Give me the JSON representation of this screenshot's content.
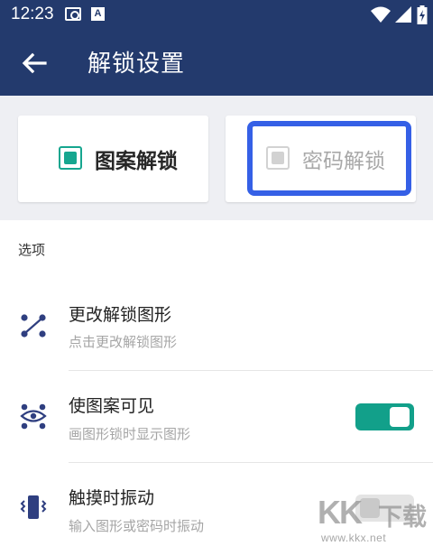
{
  "status_bar": {
    "time": "12:23",
    "notif_icons": [
      "photo-icon",
      "a-icon"
    ],
    "right_icons": [
      "wifi-icon",
      "signal-icon",
      "battery-charging-icon"
    ],
    "a_glyph": "A"
  },
  "app_bar": {
    "title": "解锁设置",
    "back_icon": "back-arrow-icon",
    "color": "#233a6d"
  },
  "unlock_modes": [
    {
      "label": "图案解锁",
      "selected": true,
      "check_color": "#16a68f"
    },
    {
      "label": "密码解锁",
      "selected": false,
      "highlighted": true,
      "highlight_color": "#3560e6"
    }
  ],
  "section": {
    "header": "选项"
  },
  "options": [
    {
      "title": "更改解锁图形",
      "subtitle": "点击更改解锁图形",
      "icon": "pattern-icon",
      "toggle": null
    },
    {
      "title": "使图案可见",
      "subtitle": "画图形锁时显示图形",
      "icon": "eye-pattern-icon",
      "toggle": true
    },
    {
      "title": "触摸时振动",
      "subtitle": "输入图形或密码时振动",
      "icon": "vibrate-icon",
      "toggle": false
    }
  ],
  "accent_color": "#12a08a",
  "watermark": {
    "mark": "KK",
    "text": "下载",
    "url": "www.kkx.net"
  }
}
